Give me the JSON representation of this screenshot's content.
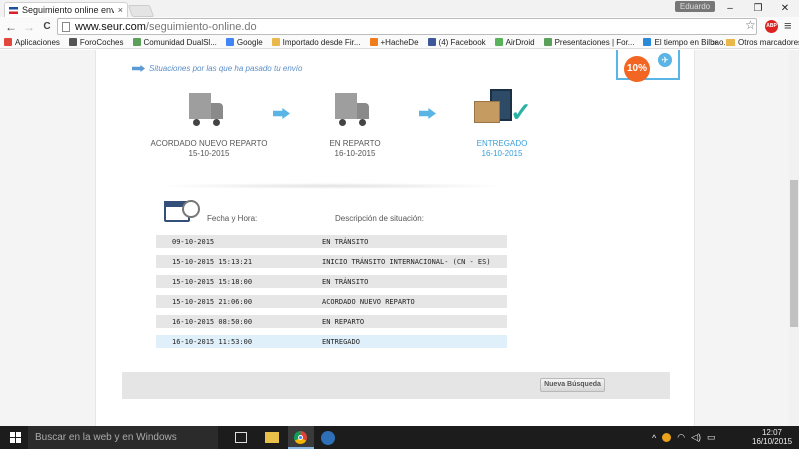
{
  "browser": {
    "tab_title": "Seguimiento online envío",
    "tab_close": "×",
    "user_name": "Eduardo",
    "win_minimize": "–",
    "win_maximize": "❐",
    "win_close": "✕",
    "url_host": "www.seur.com",
    "url_path": "/seguimiento-online.do",
    "back": "←",
    "forward": "→",
    "reload": "C",
    "star": "☆",
    "abp_label": "ABP",
    "menu": "≡"
  },
  "bookmarks": {
    "items": [
      {
        "label": "Aplicaciones",
        "color": "#e0483e"
      },
      {
        "label": "ForoCoches",
        "color": "#555555"
      },
      {
        "label": "Comunidad DualSl...",
        "color": "#5aa05a"
      },
      {
        "label": "Google",
        "color": "#4285f4"
      },
      {
        "label": "Importado desde Fir...",
        "color": "#e8b84a"
      },
      {
        "label": "+HacheDe",
        "color": "#f07c1e"
      },
      {
        "label": "(4) Facebook",
        "color": "#3b5998"
      },
      {
        "label": "AirDroid",
        "color": "#59b35a"
      },
      {
        "label": "Presentaciones | For...",
        "color": "#5aa05a"
      },
      {
        "label": "El tiempo en Bilbao...",
        "color": "#2b8ad8"
      }
    ],
    "more": "»",
    "other": "Otros marcadores"
  },
  "tracking": {
    "situations_heading": "Situaciones por las que ha pasado tu envío",
    "promo_badge": "10%",
    "steps": [
      {
        "label": "ACORDADO NUEVO REPARTO",
        "date": "15-10-2015"
      },
      {
        "label": "EN REPARTO",
        "date": "16-10-2015"
      },
      {
        "label": "ENTREGADO",
        "date": "16-10-2015"
      }
    ],
    "col_date": "Fecha y Hora:",
    "col_desc": "Descripción de situación:",
    "rows": [
      {
        "date": "09-10-2015",
        "desc": "EN TRÁNSITO"
      },
      {
        "date": "15-10-2015 15:13:21",
        "desc": "INICIO TRÁNSITO INTERNACIONAL- (CN - ES)"
      },
      {
        "date": "15-10-2015 15:18:00",
        "desc": "EN TRÁNSITO"
      },
      {
        "date": "15-10-2015 21:06:00",
        "desc": "ACORDADO NUEVO REPARTO"
      },
      {
        "date": "16-10-2015 08:50:00",
        "desc": "EN REPARTO"
      },
      {
        "date": "16-10-2015 11:53:00",
        "desc": "ENTREGADO"
      }
    ],
    "new_search_button": "Nueva Búsqueda"
  },
  "taskbar": {
    "search_placeholder": "Buscar en la web y en Windows",
    "tray_chevron": "^",
    "time": "12:07",
    "date": "16/10/2015"
  },
  "colors": {
    "accent_blue": "#3a9fd6",
    "promo_orange": "#f26522",
    "check_teal": "#2bb1a3"
  }
}
